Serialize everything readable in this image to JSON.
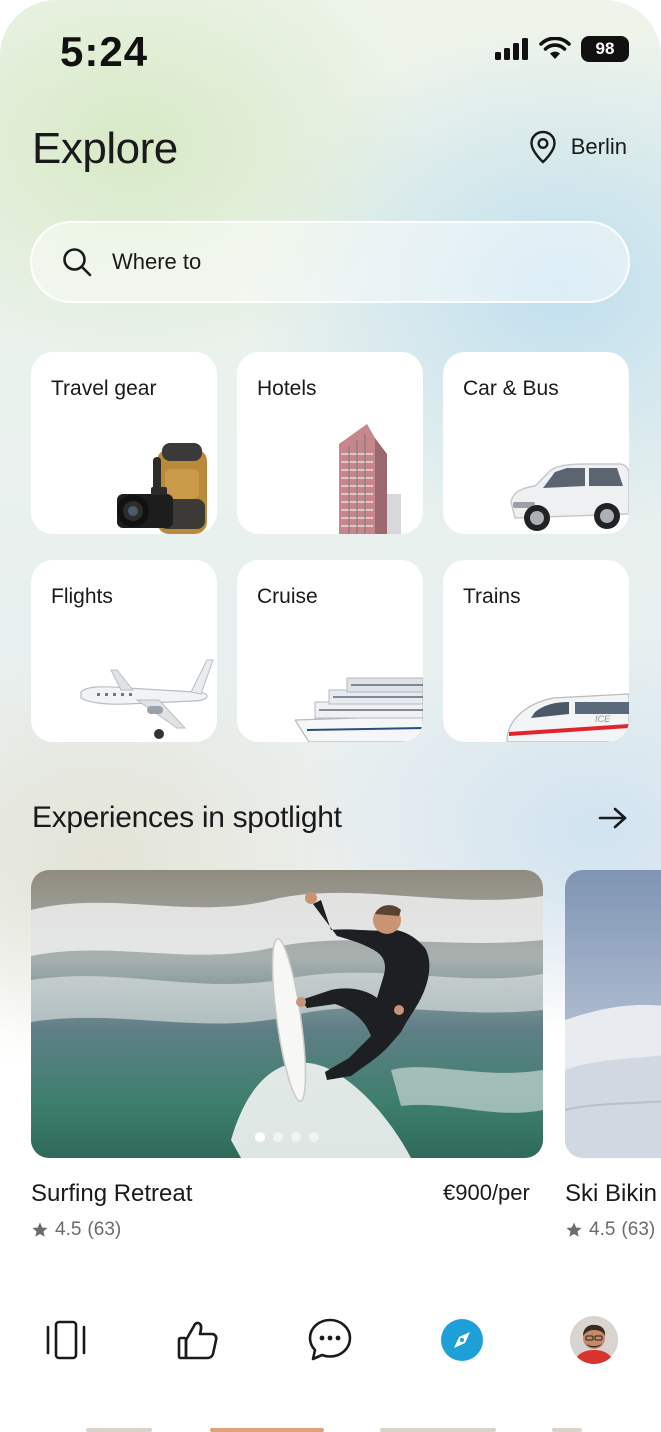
{
  "status_bar": {
    "time": "5:24",
    "battery": "98"
  },
  "header": {
    "title": "Explore",
    "location": "Berlin",
    "location_icon": "location-pin-icon"
  },
  "search": {
    "placeholder": "Where to",
    "value": "",
    "icon": "search-icon"
  },
  "categories": [
    {
      "label": "Travel gear",
      "icon": "backpack-camera-image"
    },
    {
      "label": "Hotels",
      "icon": "hotel-building-image"
    },
    {
      "label": "Car & Bus",
      "icon": "suv-car-image"
    },
    {
      "label": "Flights",
      "icon": "airplane-image"
    },
    {
      "label": "Cruise",
      "icon": "cruise-ship-image"
    },
    {
      "label": "Trains",
      "icon": "ice-train-image"
    }
  ],
  "section": {
    "title": "Experiences in spotlight",
    "arrow_icon": "arrow-right-icon"
  },
  "experiences": [
    {
      "name": "Surfing Retreat",
      "price": "€900/per",
      "rating": "4.5",
      "reviews": "(63)",
      "carousel_pages": 4,
      "active_page": 1
    },
    {
      "name": "Ski Biking",
      "name_visible": "Ski Bikin",
      "rating": "4.5",
      "reviews": "(63)"
    }
  ],
  "tabbar": {
    "items": [
      {
        "name": "cards-icon",
        "active": false
      },
      {
        "name": "thumbs-up-icon",
        "active": false
      },
      {
        "name": "chat-icon",
        "active": false
      },
      {
        "name": "compass-icon",
        "active": true
      },
      {
        "name": "profile-avatar",
        "active": false
      }
    ]
  },
  "colors": {
    "accent": "#1e9fd8",
    "text": "#1a1a1c",
    "muted": "#6b6b70",
    "card": "#ffffff"
  }
}
